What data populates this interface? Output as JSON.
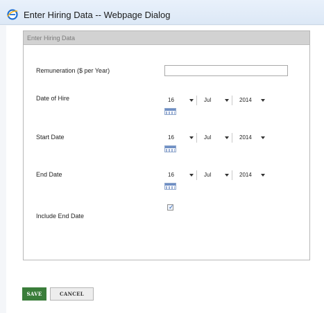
{
  "window": {
    "title": "Enter Hiring Data -- Webpage Dialog",
    "icon": "ie-icon"
  },
  "panel": {
    "header": "Enter Hiring Data"
  },
  "fields": {
    "remuneration": {
      "label": "Remuneration ($ per Year)",
      "value": ""
    },
    "date_of_hire": {
      "label": "Date of Hire",
      "day": "16",
      "month": "Jul",
      "year": "2014"
    },
    "start_date": {
      "label": "Start Date",
      "day": "16",
      "month": "Jul",
      "year": "2014"
    },
    "end_date": {
      "label": "End Date",
      "day": "16",
      "month": "Jul",
      "year": "2014"
    },
    "include_end_date": {
      "label": "Include End Date",
      "checked": true
    }
  },
  "buttons": {
    "save": "SAVE",
    "cancel": "CANCEL"
  },
  "colors": {
    "save_button": "#3a7d3a",
    "panel_header": "#d2d2d2",
    "title_bar": "#dce8f6"
  }
}
